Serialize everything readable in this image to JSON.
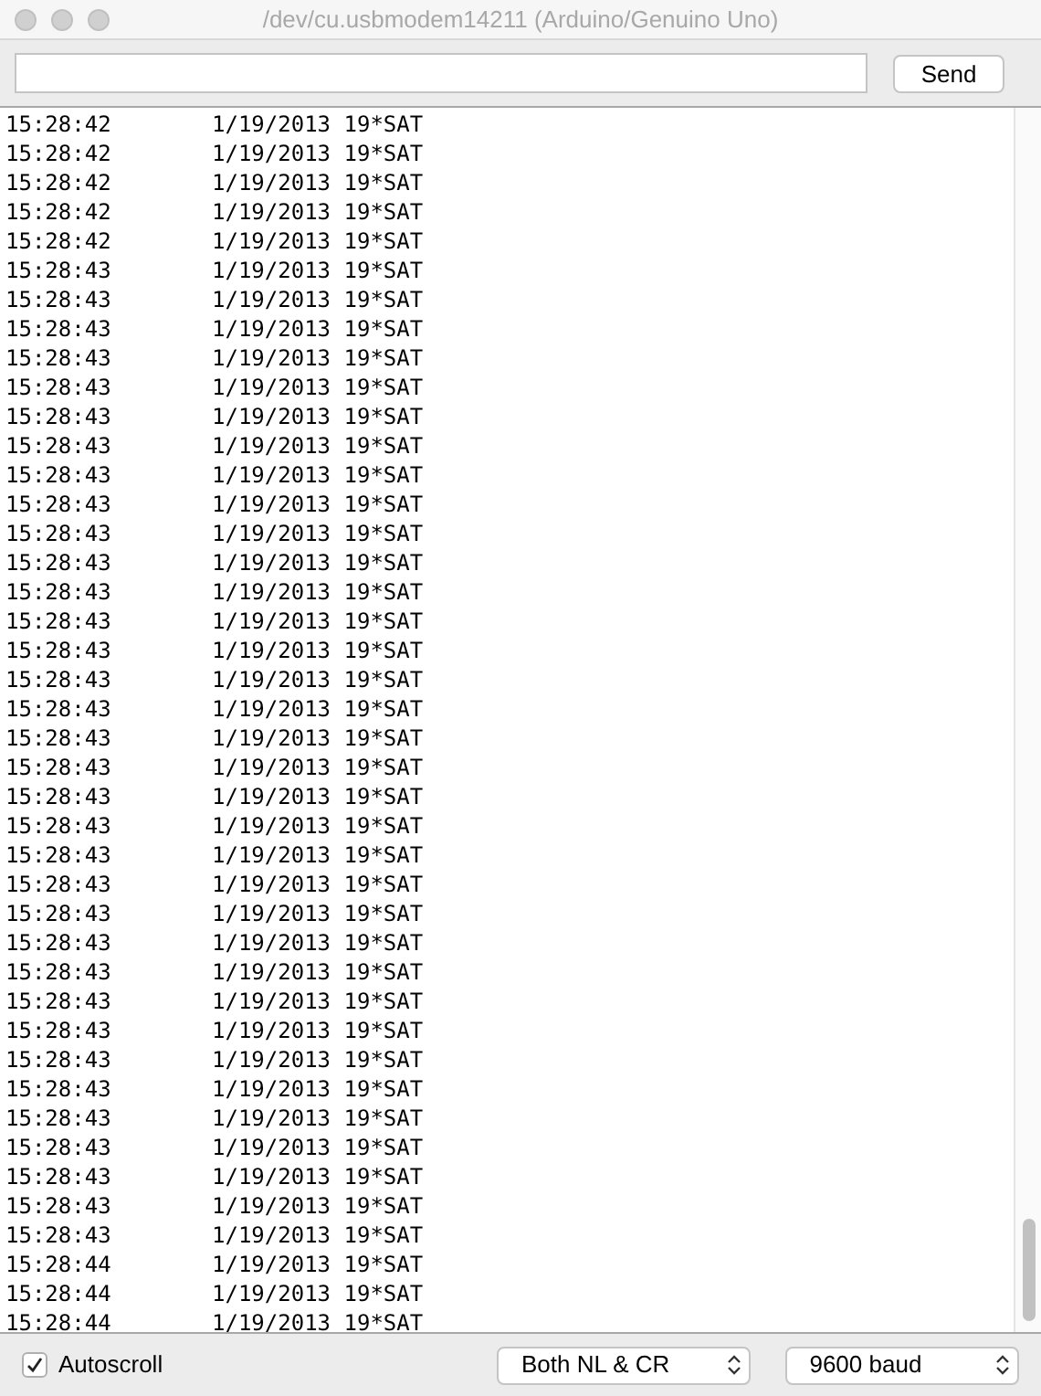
{
  "window": {
    "title": "/dev/cu.usbmodem14211 (Arduino/Genuino Uno)"
  },
  "send_button": "Send",
  "log": [
    {
      "time": "15:28:42",
      "message": "1/19/2013 19*SAT"
    },
    {
      "time": "15:28:42",
      "message": "1/19/2013 19*SAT"
    },
    {
      "time": "15:28:42",
      "message": "1/19/2013 19*SAT"
    },
    {
      "time": "15:28:42",
      "message": "1/19/2013 19*SAT"
    },
    {
      "time": "15:28:42",
      "message": "1/19/2013 19*SAT"
    },
    {
      "time": "15:28:43",
      "message": "1/19/2013 19*SAT"
    },
    {
      "time": "15:28:43",
      "message": "1/19/2013 19*SAT"
    },
    {
      "time": "15:28:43",
      "message": "1/19/2013 19*SAT"
    },
    {
      "time": "15:28:43",
      "message": "1/19/2013 19*SAT"
    },
    {
      "time": "15:28:43",
      "message": "1/19/2013 19*SAT"
    },
    {
      "time": "15:28:43",
      "message": "1/19/2013 19*SAT"
    },
    {
      "time": "15:28:43",
      "message": "1/19/2013 19*SAT"
    },
    {
      "time": "15:28:43",
      "message": "1/19/2013 19*SAT"
    },
    {
      "time": "15:28:43",
      "message": "1/19/2013 19*SAT"
    },
    {
      "time": "15:28:43",
      "message": "1/19/2013 19*SAT"
    },
    {
      "time": "15:28:43",
      "message": "1/19/2013 19*SAT"
    },
    {
      "time": "15:28:43",
      "message": "1/19/2013 19*SAT"
    },
    {
      "time": "15:28:43",
      "message": "1/19/2013 19*SAT"
    },
    {
      "time": "15:28:43",
      "message": "1/19/2013 19*SAT"
    },
    {
      "time": "15:28:43",
      "message": "1/19/2013 19*SAT"
    },
    {
      "time": "15:28:43",
      "message": "1/19/2013 19*SAT"
    },
    {
      "time": "15:28:43",
      "message": "1/19/2013 19*SAT"
    },
    {
      "time": "15:28:43",
      "message": "1/19/2013 19*SAT"
    },
    {
      "time": "15:28:43",
      "message": "1/19/2013 19*SAT"
    },
    {
      "time": "15:28:43",
      "message": "1/19/2013 19*SAT"
    },
    {
      "time": "15:28:43",
      "message": "1/19/2013 19*SAT"
    },
    {
      "time": "15:28:43",
      "message": "1/19/2013 19*SAT"
    },
    {
      "time": "15:28:43",
      "message": "1/19/2013 19*SAT"
    },
    {
      "time": "15:28:43",
      "message": "1/19/2013 19*SAT"
    },
    {
      "time": "15:28:43",
      "message": "1/19/2013 19*SAT"
    },
    {
      "time": "15:28:43",
      "message": "1/19/2013 19*SAT"
    },
    {
      "time": "15:28:43",
      "message": "1/19/2013 19*SAT"
    },
    {
      "time": "15:28:43",
      "message": "1/19/2013 19*SAT"
    },
    {
      "time": "15:28:43",
      "message": "1/19/2013 19*SAT"
    },
    {
      "time": "15:28:43",
      "message": "1/19/2013 19*SAT"
    },
    {
      "time": "15:28:43",
      "message": "1/19/2013 19*SAT"
    },
    {
      "time": "15:28:43",
      "message": "1/19/2013 19*SAT"
    },
    {
      "time": "15:28:43",
      "message": "1/19/2013 19*SAT"
    },
    {
      "time": "15:28:43",
      "message": "1/19/2013 19*SAT"
    },
    {
      "time": "15:28:44",
      "message": "1/19/2013 19*SAT"
    },
    {
      "time": "15:28:44",
      "message": "1/19/2013 19*SAT"
    },
    {
      "time": "15:28:44",
      "message": "1/19/2013 19*SAT"
    }
  ],
  "autoscroll": {
    "label": "Autoscroll",
    "checked": true
  },
  "line_ending": "Both NL & CR",
  "baud_rate": "9600 baud"
}
